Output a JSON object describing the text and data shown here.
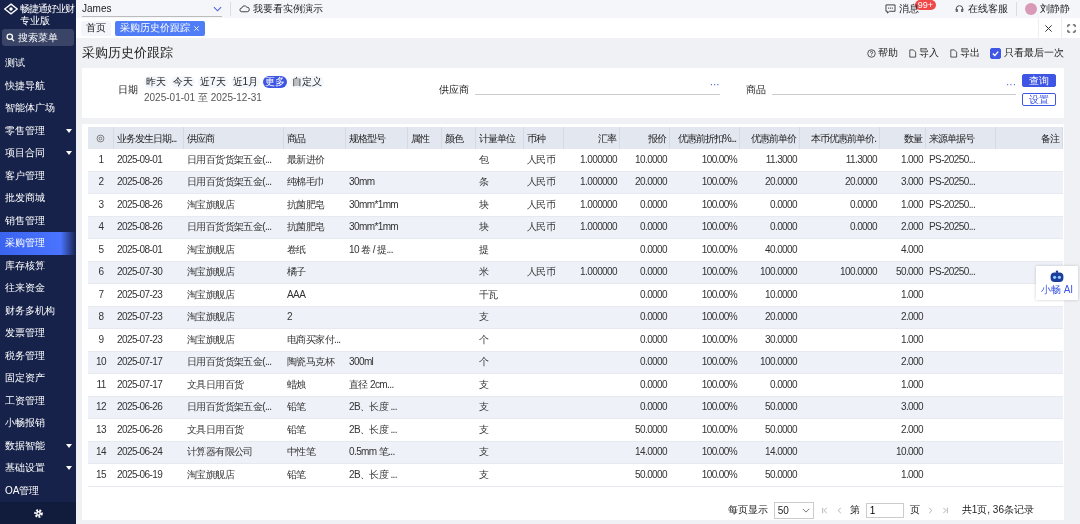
{
  "sidebar": {
    "logo_name": "畅捷通好业财",
    "edition": "专业版",
    "search": "搜索菜单",
    "items": [
      {
        "label": "测试",
        "expandable": false,
        "selected": false
      },
      {
        "label": "快捷导航",
        "expandable": false,
        "selected": false
      },
      {
        "label": "智能体广场",
        "expandable": false,
        "selected": false
      },
      {
        "label": "零售管理",
        "expandable": true,
        "selected": false
      },
      {
        "label": "项目合同",
        "expandable": true,
        "selected": false
      },
      {
        "label": "客户管理",
        "expandable": false,
        "selected": false
      },
      {
        "label": "批发商城",
        "expandable": false,
        "selected": false
      },
      {
        "label": "销售管理",
        "expandable": false,
        "selected": false
      },
      {
        "label": "采购管理",
        "expandable": false,
        "selected": true
      },
      {
        "label": "库存核算",
        "expandable": false,
        "selected": false
      },
      {
        "label": "往来资金",
        "expandable": false,
        "selected": false
      },
      {
        "label": "财务多机构",
        "expandable": false,
        "selected": false
      },
      {
        "label": "发票管理",
        "expandable": false,
        "selected": false
      },
      {
        "label": "税务管理",
        "expandable": false,
        "selected": false
      },
      {
        "label": "固定资产",
        "expandable": false,
        "selected": false
      },
      {
        "label": "工资管理",
        "expandable": false,
        "selected": false
      },
      {
        "label": "小畅报销",
        "expandable": false,
        "selected": false
      },
      {
        "label": "数据智能",
        "expandable": true,
        "selected": false
      },
      {
        "label": "基础设置",
        "expandable": true,
        "selected": false
      },
      {
        "label": "OA管理",
        "expandable": false,
        "selected": false
      }
    ]
  },
  "topbar": {
    "account": "James",
    "demo": "我要看实例演示",
    "messages": "消息",
    "badge": "99+",
    "service": "在线客服",
    "user": "刘静静"
  },
  "tabs": [
    {
      "label": "首页",
      "selected": false,
      "closable": false
    },
    {
      "label": "采购历史价跟踪",
      "selected": true,
      "closable": true
    }
  ],
  "page": {
    "title": "采购历史价跟踪",
    "actions": [
      {
        "label": "帮助",
        "kind": "help"
      },
      {
        "label": "导入",
        "kind": "file"
      },
      {
        "label": "导出",
        "kind": "file"
      }
    ],
    "last_only": {
      "label": "只看最后一次",
      "checked": true
    }
  },
  "filters": {
    "date_label": "日期",
    "quick": [
      {
        "label": "昨天",
        "selected": false
      },
      {
        "label": "今天",
        "selected": false
      },
      {
        "label": "近7天",
        "selected": false
      },
      {
        "label": "近1月",
        "selected": false
      },
      {
        "label": "更多",
        "selected": true
      },
      {
        "label": "自定义",
        "selected": false
      }
    ],
    "range": "2025-01-01 至 2025-12-31",
    "fields": [
      {
        "label": "供应商",
        "more": "···"
      },
      {
        "label": "商品",
        "more": "···"
      }
    ],
    "query": "查询",
    "settings": "设置"
  },
  "table": {
    "columns": [
      "业务发生日期...",
      "供应商",
      "商品",
      "规格型号",
      "属性",
      "颜色",
      "计量单位",
      "币种",
      "汇率",
      "报价",
      "优惠前折扣%...",
      "优惠前单价",
      "本币优惠前单价.",
      "数量",
      "来源单据号",
      "备注"
    ],
    "rows": [
      {
        "no": "1",
        "date": "2025-09-01",
        "supplier": "日用百货货架五金(...",
        "goods": "最新进价",
        "unit": "包",
        "currency": "人民币",
        "rate": "1.000000",
        "price": "10.0000",
        "discount": "100.00%",
        "pre_price": "11.3000",
        "local_pre_price": "11.3000",
        "qty": "1.000",
        "source": "PS-20250..."
      },
      {
        "no": "2",
        "date": "2025-08-26",
        "supplier": "日用百货货架五金(...",
        "goods": "纯棉毛巾",
        "spec": "30mm",
        "unit": "条",
        "currency": "人民币",
        "rate": "1.000000",
        "price": "20.0000",
        "discount": "100.00%",
        "pre_price": "20.0000",
        "local_pre_price": "20.0000",
        "qty": "3.000",
        "source": "PS-20250..."
      },
      {
        "no": "3",
        "date": "2025-08-26",
        "supplier": "淘宝旗舰店",
        "goods": "抗菌肥皂",
        "spec": "30mm*1mm",
        "unit": "块",
        "currency": "人民币",
        "rate": "1.000000",
        "price": "0.0000",
        "discount": "100.00%",
        "pre_price": "0.0000",
        "local_pre_price": "0.0000",
        "qty": "1.000",
        "source": "PS-20250..."
      },
      {
        "no": "4",
        "date": "2025-08-26",
        "supplier": "日用百货货架五金(...",
        "goods": "抗菌肥皂",
        "spec": "30mm*1mm",
        "unit": "块",
        "currency": "人民币",
        "rate": "1.000000",
        "price": "0.0000",
        "discount": "100.00%",
        "pre_price": "0.0000",
        "local_pre_price": "0.0000",
        "qty": "2.000",
        "source": "PS-20250..."
      },
      {
        "no": "5",
        "date": "2025-08-01",
        "supplier": "淘宝旗舰店",
        "goods": "卷纸",
        "spec": "10 卷 / 提...",
        "unit": "提",
        "price": "0.0000",
        "discount": "100.00%",
        "pre_price": "40.0000",
        "qty": "4.000"
      },
      {
        "no": "6",
        "date": "2025-07-30",
        "supplier": "淘宝旗舰店",
        "goods": "橘子",
        "unit": "米",
        "currency": "人民币",
        "rate": "1.000000",
        "price": "0.0000",
        "discount": "100.00%",
        "pre_price": "100.0000",
        "local_pre_price": "100.0000",
        "qty": "50.000",
        "source": "PS-20250..."
      },
      {
        "no": "7",
        "date": "2025-07-23",
        "supplier": "淘宝旗舰店",
        "goods": "AAA",
        "unit": "千瓦",
        "price": "0.0000",
        "discount": "100.00%",
        "pre_price": "10.0000",
        "qty": "1.000"
      },
      {
        "no": "8",
        "date": "2025-07-23",
        "supplier": "淘宝旗舰店",
        "goods": "2",
        "unit": "支",
        "price": "0.0000",
        "discount": "100.00%",
        "pre_price": "20.0000",
        "qty": "2.000"
      },
      {
        "no": "9",
        "date": "2025-07-23",
        "supplier": "淘宝旗舰店",
        "goods": "电商买家付...",
        "unit": "个",
        "price": "0.0000",
        "discount": "100.00%",
        "pre_price": "30.0000",
        "qty": "1.000"
      },
      {
        "no": "10",
        "date": "2025-07-17",
        "supplier": "日用百货货架五金(...",
        "goods": "陶瓷马克杯",
        "spec": "300ml",
        "unit": "个",
        "price": "0.0000",
        "discount": "100.00%",
        "pre_price": "100.0000",
        "qty": "2.000"
      },
      {
        "no": "11",
        "date": "2025-07-17",
        "supplier": "文具日用百货",
        "goods": "蜡烛",
        "spec": "直径 2cm...",
        "unit": "支",
        "price": "0.0000",
        "discount": "100.00%",
        "pre_price": "0.0000",
        "qty": "1.000"
      },
      {
        "no": "12",
        "date": "2025-06-26",
        "supplier": "日用百货货架五金(...",
        "goods": "铅笔",
        "spec": "2B、长度 ...",
        "unit": "支",
        "price": "0.0000",
        "discount": "100.00%",
        "pre_price": "50.0000",
        "qty": "3.000"
      },
      {
        "no": "13",
        "date": "2025-06-26",
        "supplier": "文具日用百货",
        "goods": "铅笔",
        "spec": "2B、长度 ...",
        "unit": "支",
        "price": "50.0000",
        "discount": "100.00%",
        "pre_price": "50.0000",
        "qty": "2.000"
      },
      {
        "no": "14",
        "date": "2025-06-24",
        "supplier": "计算器有限公司",
        "goods": "中性笔",
        "spec": "0.5mm 笔...",
        "unit": "支",
        "price": "14.0000",
        "discount": "100.00%",
        "pre_price": "14.0000",
        "qty": "10.000"
      },
      {
        "no": "15",
        "date": "2025-06-19",
        "supplier": "淘宝旗舰店",
        "goods": "铅笔",
        "spec": "2B、长度 ...",
        "unit": "支",
        "price": "50.0000",
        "discount": "100.00%",
        "pre_price": "50.0000",
        "qty": "1.000"
      }
    ]
  },
  "pagination": {
    "per_page_label": "每页显示",
    "per_page": "50",
    "page_prefix": "第",
    "page": "1",
    "page_suffix": "页",
    "summary": "共1页, 36条记录"
  },
  "assistant": {
    "label": "小畅 AI"
  }
}
